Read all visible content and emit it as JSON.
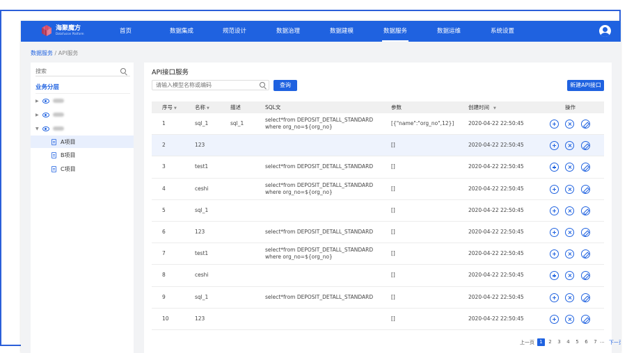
{
  "header": {
    "logo_title": "海聚魔方",
    "logo_sub": "DataFusion Platform",
    "nav": [
      {
        "label": "首页",
        "active": false
      },
      {
        "label": "数据集成",
        "active": false
      },
      {
        "label": "规范设计",
        "active": false
      },
      {
        "label": "数据治理",
        "active": false
      },
      {
        "label": "数据建模",
        "active": false
      },
      {
        "label": "数据服务",
        "active": true
      },
      {
        "label": "数据运维",
        "active": false
      },
      {
        "label": "系统设置",
        "active": false
      }
    ]
  },
  "breadcrumb": {
    "link": "数据服务",
    "sep": " / ",
    "current": "API服务"
  },
  "sidebar": {
    "search_placeholder": "搜索",
    "title": "业务分层",
    "leaves": [
      "A项目",
      "B项目",
      "C项目"
    ]
  },
  "main": {
    "title": "API接口服务",
    "search_placeholder": "请输入模型名称或编码",
    "search_button": "查询",
    "new_button": "新建API接口",
    "columns": [
      "序号",
      "名称",
      "描述",
      "SQL文",
      "参数",
      "创建时间",
      "操作"
    ],
    "rows": [
      {
        "no": "1",
        "name": "sql_1",
        "desc": "sql_1",
        "sql1": "select*from DEPOSIT_DETALL_STANDARD",
        "sql2": "where org_no=${org_no}",
        "param": "[{\"name\":\"org_no\",12}]",
        "time": "2020-04-22 22:50:45"
      },
      {
        "no": "2",
        "name": "123",
        "desc": "",
        "sql1": "",
        "sql2": "",
        "param": "[]",
        "time": "2020-04-22 22:50:45"
      },
      {
        "no": "3",
        "name": "test1",
        "desc": "",
        "sql1": "select*from DEPOSIT_DETALL_STANDARD",
        "sql2": "",
        "param": "[]",
        "time": "2020-04-22 22:50:45"
      },
      {
        "no": "4",
        "name": "ceshi",
        "desc": "",
        "sql1": "select*from DEPOSIT_DETALL_STANDARD",
        "sql2": "where org_no=${org_no}",
        "param": "[]",
        "time": "2020-04-22 22:50:45"
      },
      {
        "no": "5",
        "name": "sql_1",
        "desc": "",
        "sql1": "",
        "sql2": "",
        "param": "[]",
        "time": "2020-04-22 22:50:45"
      },
      {
        "no": "6",
        "name": "123",
        "desc": "",
        "sql1": "select*from DEPOSIT_DETALL_STANDARD",
        "sql2": "",
        "param": "[]",
        "time": "2020-04-22 22:50:45"
      },
      {
        "no": "7",
        "name": "test1",
        "desc": "",
        "sql1": "select*from DEPOSIT_DETALL_STANDARD",
        "sql2": "where org_no=${org_no}",
        "param": "[]",
        "time": "2020-04-22 22:50:45"
      },
      {
        "no": "8",
        "name": "ceshi",
        "desc": "",
        "sql1": "",
        "sql2": "",
        "param": "[]",
        "time": "2020-04-22 22:50:45"
      },
      {
        "no": "9",
        "name": "sql_1",
        "desc": "",
        "sql1": "select*from DEPOSIT_DETALL_STANDARD",
        "sql2": "",
        "param": "[]",
        "time": "2020-04-22 22:50:45"
      },
      {
        "no": "10",
        "name": "123",
        "desc": "",
        "sql1": "",
        "sql2": "",
        "param": "[]",
        "time": "2020-04-22 22:50:45"
      }
    ]
  },
  "pagination": {
    "prev": "上一页",
    "pages": [
      "1",
      "2",
      "3",
      "4",
      "5",
      "6",
      "7"
    ],
    "ellipsis": "···",
    "next": "下一页",
    "current": "1"
  },
  "colors": {
    "primary": "#1f62e0",
    "highlight_row": "#eef3fd"
  }
}
